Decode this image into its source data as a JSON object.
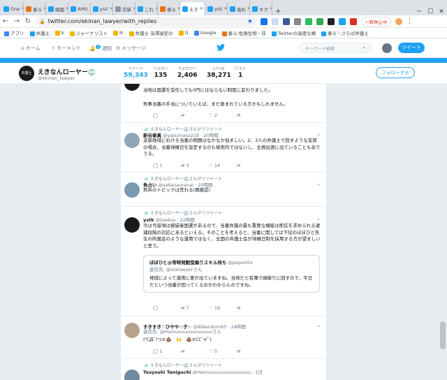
{
  "browser": {
    "tabs": [
      {
        "label": "One",
        "color": "#1da1f2"
      },
      {
        "label": "泰斗",
        "color": "#e8710a"
      },
      {
        "label": "縮図",
        "color": "#1da1f2"
      },
      {
        "label": "AMU",
        "color": "#1da1f2"
      },
      {
        "label": "ysti",
        "color": "#1da1f2"
      },
      {
        "label": "京新",
        "color": "#8899a6"
      },
      {
        "label": "これ",
        "color": "#1da1f2"
      },
      {
        "label": "泰斗",
        "color": "#e8710a"
      },
      {
        "label": "えき",
        "color": "#1da1f2"
      },
      {
        "label": "ysti",
        "color": "#1da1f2"
      },
      {
        "label": "高杉",
        "color": "#1da1f2"
      },
      {
        "label": "キク",
        "color": "#1da1f2"
      }
    ],
    "new_tab": "+",
    "url": "twitter.com/ekinan_lawyer/with_replies",
    "paused": "一時停止中",
    "bookmarks": [
      {
        "label": "アプリ",
        "color": "#4285f4"
      },
      {
        "label": "弁護士",
        "color": "#1da1f2"
      },
      {
        "label": "k",
        "color": "#f4b400"
      },
      {
        "label": "ジャーナリスト",
        "color": "#f4b400"
      },
      {
        "label": "lk",
        "color": "#f4b400"
      },
      {
        "label": "弁護士 深澤諭史の",
        "color": "#f4b400"
      },
      {
        "label": "G",
        "color": "#f4b400"
      },
      {
        "label": "Google",
        "color": "#4285f4"
      },
      {
        "label": "泰斗:危険生物・非",
        "color": "#e8710a"
      },
      {
        "label": "Twitterの高度な検",
        "color": "#1da1f2"
      },
      {
        "label": "泰斗＼さらば弁護士",
        "color": "#1da1f2"
      }
    ]
  },
  "twitter_nav": {
    "home": "ホーム",
    "moments": "モーメント",
    "notifications": "通知",
    "notif_count": "1",
    "messages": "メッセージ",
    "search_placeholder": "キーワード検索",
    "tweet_button": "ツイート"
  },
  "profile": {
    "name": "えきなんローヤー⚖️",
    "handle": "@ekinan_lawyer",
    "avatar_text": "弁護士",
    "stats": [
      {
        "label": "ツイート",
        "value": "59,343"
      },
      {
        "label": "フォロー",
        "value": "135"
      },
      {
        "label": "フォロワー",
        "value": "2,406"
      },
      {
        "label": "いいね",
        "value": "38,271"
      },
      {
        "label": "リスト",
        "value": "1"
      }
    ],
    "follow_button": "フォローする"
  },
  "tweets": [
    {
      "body1": "当地は国選を受任しても0円にはならない制度に変わりました。",
      "body2": "刑事当番の手当についていえば、まだ恵まれている方かもしれません。",
      "replies": "",
      "retweets": "",
      "likes": "2"
    },
    {
      "retweeted_by": "えきなんローヤー⚖️さんがリツイート",
      "name": "新谷泰真",
      "handle": "@yasumasa218",
      "time": "20時間",
      "body": "支部地域における当番の問題はなかなか悩ましい。2、3人の弁護士で回すような支部の場合、当番待機日を設定するのも現実的ではないし、全員出張に出ていることもありうる。",
      "replies": "1",
      "retweets": "3",
      "likes": "14"
    },
    {
      "retweeted_by": "えきなんローヤー⚖️さんがリツイート",
      "name": "魚占い",
      "handle": "@sakanauranai",
      "time": "20時間",
      "body": "刑弁のトピックは荒れる(再確認)",
      "replies": "",
      "retweets": "",
      "likes": ""
    },
    {
      "retweeted_by": "えきなんローヤー⚖️さんがリツイート",
      "name": "ystk",
      "handle": "@lawkus",
      "time": "22時間",
      "body": "今は弓留頃は被疑者国選があるので、当番弁護の最も重要な機能は即応を求められる逮捕段階の対応にあるといえる。そのことを考えると、当番に関しては下記のぼぼひと先生の所属会のような運用ではなく、全国の弁護士会が待機日制を採用する方が望ましいと思う。",
      "quote_name": "ぼぼひと@常時発動型煽りスキル持ち",
      "quote_handle": "@popohito",
      "quote_reply": "返信先: @otalawyerさん",
      "quote_body": "地域によって運用に差が出ていますね。当地だと名簿で順繰りに回すので、平日だといつ当番が回ってくるのかわからんのですね。",
      "replies": "",
      "retweets": "7",
      "likes": "18"
    },
    {
      "name": "すきすき♡ひやや☆子☆",
      "handle": "@Bibendum65",
      "time": "24時間",
      "reply_to": "返信先: @Hamuuuuuuuuuuuuuさん",
      "body": "(*ﾟДﾟ)つ≡💩　🙌　💩≡C(ﾟ∀ﾟ)",
      "replies": "1",
      "retweets": "",
      "likes": "5"
    },
    {
      "retweeted_by": "えきなんローヤー⚖️さんがリツイート",
      "name": "Tsuyoshi Taniguchi",
      "handle": "@Hamuuuuuuuuuuuuuuu",
      "time": "1日",
      "body": ""
    }
  ]
}
